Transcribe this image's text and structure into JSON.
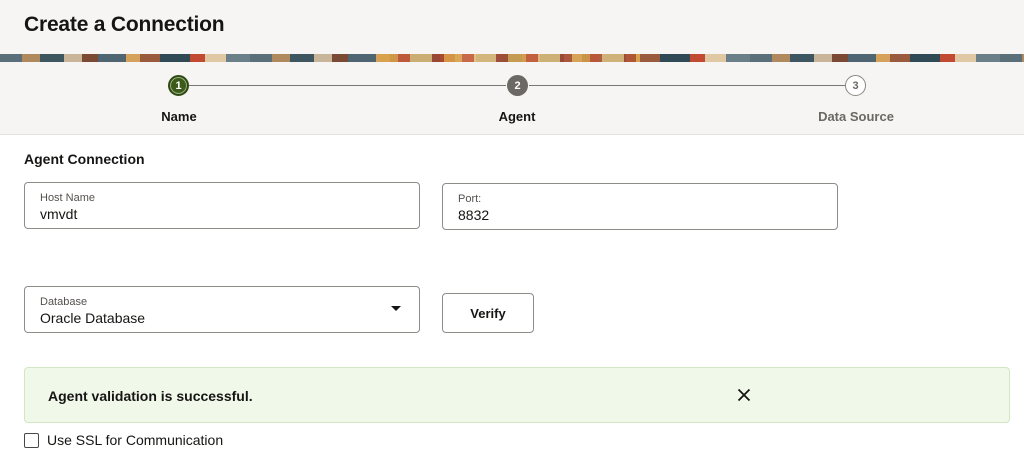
{
  "header": {
    "title": "Create a Connection"
  },
  "stepper": {
    "steps": [
      {
        "number": "1",
        "label": "Name",
        "state": "done"
      },
      {
        "number": "2",
        "label": "Agent",
        "state": "current"
      },
      {
        "number": "3",
        "label": "Data Source",
        "state": "todo"
      }
    ]
  },
  "section": {
    "title": "Agent Connection"
  },
  "host": {
    "label": "Host Name",
    "value": "vmvdt"
  },
  "port": {
    "label": "Port:",
    "value": "8832"
  },
  "database": {
    "label": "Database",
    "value": "Oracle Database"
  },
  "verify": {
    "label": "Verify"
  },
  "alert": {
    "message": "Agent validation is successful.",
    "close_icon": "close-icon"
  },
  "ssl": {
    "label": "Use SSL for Communication",
    "checked": false
  },
  "colors": {
    "step_done": "#3c5a1a",
    "alert_bg": "#f0f8ea",
    "header_bg": "#f6f5f3"
  }
}
